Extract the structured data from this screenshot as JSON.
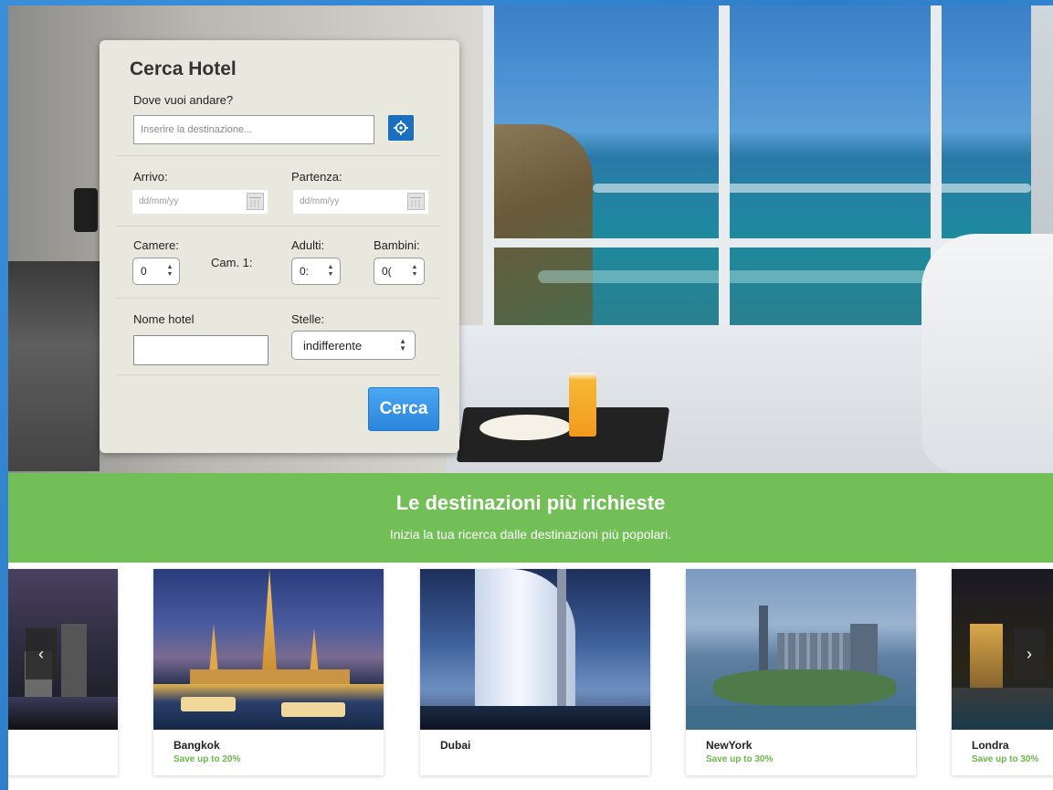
{
  "search_panel": {
    "title": "Cerca Hotel",
    "destination_label": "Dove vuoi andare?",
    "destination_placeholder": "Inserire la destinazione...",
    "arrival_label": "Arrivo:",
    "arrival_placeholder": "dd/mm/yy",
    "departure_label": "Partenza:",
    "departure_placeholder": "dd/mm/yy",
    "rooms_label": "Camere:",
    "rooms_value": "0",
    "room_label": "Cam. 1:",
    "adults_label": "Adulti:",
    "adults_value": "0:",
    "children_label": "Bambini:",
    "children_value": "0(",
    "hotel_name_label": "Nome hotel",
    "stars_label": "Stelle:",
    "stars_value": "indifferente",
    "search_button": "Cerca"
  },
  "banner": {
    "title": "Le destinazioni più richieste",
    "subtitle": "Inizia la tua ricerca dalle destinazioni più popolari."
  },
  "carousel": {
    "prev_glyph": "‹",
    "next_glyph": "›",
    "cards": [
      {
        "city": "",
        "save": ""
      },
      {
        "city": "Bangkok",
        "save": "Save up to 20%"
      },
      {
        "city": "Dubai",
        "save": ""
      },
      {
        "city": "NewYork",
        "save": "Save up to 30%"
      },
      {
        "city": "Londra",
        "save": "Save up to 30%"
      }
    ]
  },
  "colors": {
    "accent_blue": "#2b85dd",
    "banner_green": "#72be57",
    "save_green": "#68b84a",
    "panel_bg": "#e9e8df"
  }
}
